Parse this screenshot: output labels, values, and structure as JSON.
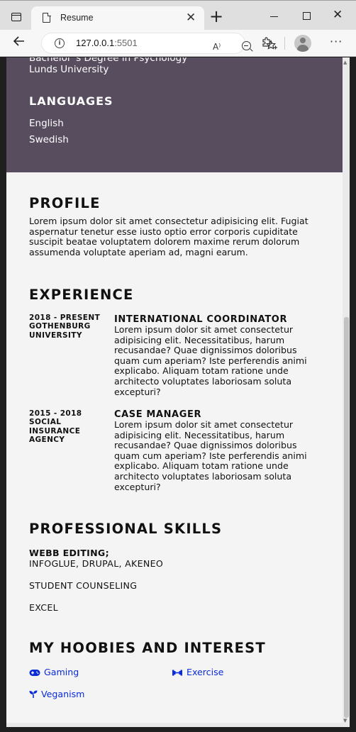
{
  "browser": {
    "tab_title": "Resume",
    "tab_close": "✕",
    "new_tab": "+",
    "url_host": "127.0.0.1",
    "url_port": ":5501",
    "read_aloud": "A⁾",
    "window_close": "✕",
    "menu": "···"
  },
  "sidebar": {
    "education_degree": "Bachelor´s Degree in Psychology",
    "education_school": "Lunds University",
    "languages_heading": "LANGUAGES",
    "languages": [
      "English",
      "Swedish"
    ]
  },
  "main": {
    "profile": {
      "heading": "PROFILE",
      "text": "Lorem ipsum dolor sit amet consectetur adipisicing elit. Fugiat aspernatur tenetur esse iusto optio error corporis cupiditate suscipit beatae voluptatem dolorem maxime rerum dolorum assumenda voluptate aperiam ad, magni earum."
    },
    "experience": {
      "heading": "EXPERIENCE",
      "items": [
        {
          "date": "2018 - PRESENT",
          "org": "GOTHENBURG UNIVERSITY",
          "title": "INTERNATIONAL COORDINATOR",
          "desc": "Lorem ipsum dolor sit amet consectetur adipisicing elit. Necessitatibus, harum recusandae? Quae dignissimos doloribus quam cum aperiam? Iste perferendis animi explicabo. Aliquam totam ratione unde architecto voluptates laboriosam soluta excepturi?"
        },
        {
          "date": "2015 - 2018",
          "org": "SOCIAL INSURANCE AGENCY",
          "title": "CASE MANAGER",
          "desc": "Lorem ipsum dolor sit amet consectetur adipisicing elit. Necessitatibus, harum recusandae? Quae dignissimos doloribus quam cum aperiam? Iste perferendis animi explicabo. Aliquam totam ratione unde architecto voluptates laboriosam soluta excepturi?"
        }
      ]
    },
    "skills": {
      "heading": "PROFESSIONAL SKILLS",
      "web_editing_label": "WEBB EDITING;",
      "web_editing_tools": "INFOGLUE, DRUPAL, AKENEO",
      "counseling": "STUDENT COUNSELING",
      "excel": "EXCEL"
    },
    "hobbies": {
      "heading": "MY HOOBIES AND INTEREST",
      "items": [
        {
          "label": "Gaming",
          "icon": "gamepad-icon"
        },
        {
          "label": "Exercise",
          "icon": "dumbbell-icon"
        },
        {
          "label": "Veganism",
          "icon": "seedling-icon"
        }
      ]
    }
  },
  "colors": {
    "sidebar_bg": "#574d5f",
    "page_bg": "#f4f4f4",
    "link": "#0a2bd8"
  }
}
